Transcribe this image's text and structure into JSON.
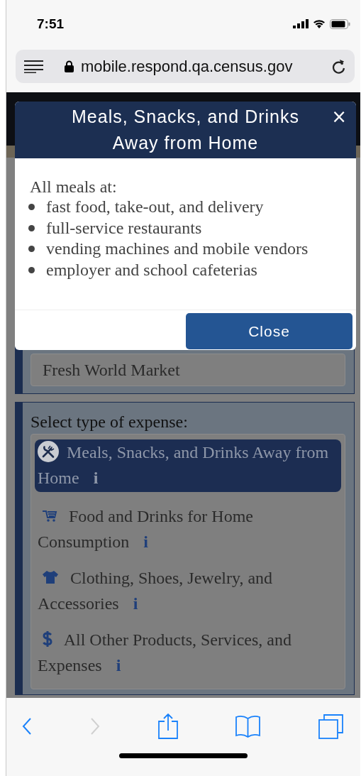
{
  "status_bar": {
    "time": "7:51"
  },
  "browser": {
    "url": "mobile.respond.qa.census.gov"
  },
  "modal": {
    "title": "Meals, Snacks, and Drinks Away from Home",
    "close_glyph": "×",
    "intro": "All meals at:",
    "items": [
      "fast food, take-out, and delivery",
      "full-service restaurants",
      "vending machines and mobile vendors",
      "employer and school cafeterias"
    ],
    "button": "Close"
  },
  "store_panel": {
    "value": "Fresh World Market"
  },
  "expense_panel": {
    "label": "Select type of expense:",
    "options": [
      {
        "kind": "meals",
        "label": "Meals, Snacks, and Drinks Away from Home",
        "info": "i",
        "selected": true
      },
      {
        "kind": "groceries",
        "label": "Food and Drinks for Home Consumption",
        "info": "i",
        "selected": false
      },
      {
        "kind": "clothing",
        "label": "Clothing, Shoes, Jewelry, and Accessories",
        "info": "i",
        "selected": false
      },
      {
        "kind": "other",
        "label": "All Other Products, Services, and Expenses",
        "info": "i",
        "selected": false
      }
    ]
  },
  "toolbar": [
    {
      "kind": "back",
      "disabled": false
    },
    {
      "kind": "forward",
      "disabled": true
    },
    {
      "kind": "share",
      "disabled": false
    },
    {
      "kind": "bookmarks",
      "disabled": false
    },
    {
      "kind": "tabs",
      "disabled": false
    }
  ]
}
